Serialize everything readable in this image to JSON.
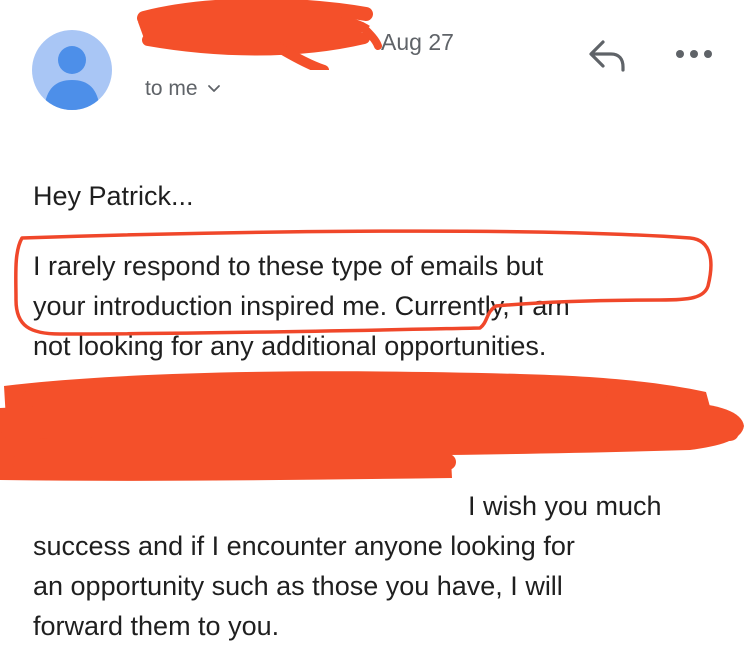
{
  "header": {
    "sender_name": "",
    "date": "Aug 27",
    "recipient_label": "to me",
    "reply_icon": "reply-arrow-icon",
    "more_icon": "more-horizontal-icon",
    "avatar_icon": "person-avatar-icon"
  },
  "body": {
    "greeting": "Hey Patrick...",
    "paragraph_lines": [
      "I rarely respond to these type of emails but",
      "your introduction inspired me.  Currently, I am",
      "not looking for any additional opportunities.",
      "",
      "",
      "",
      "I wish you much",
      "success and if I encounter anyone looking for",
      "an opportunity such as those you have, I will",
      "forward them to you."
    ]
  },
  "annotation_colors": {
    "redaction": "#f4502a",
    "outline": "#f0472a",
    "avatar_bg": "#a9c6f5",
    "avatar_fg": "#4d8fe9"
  }
}
